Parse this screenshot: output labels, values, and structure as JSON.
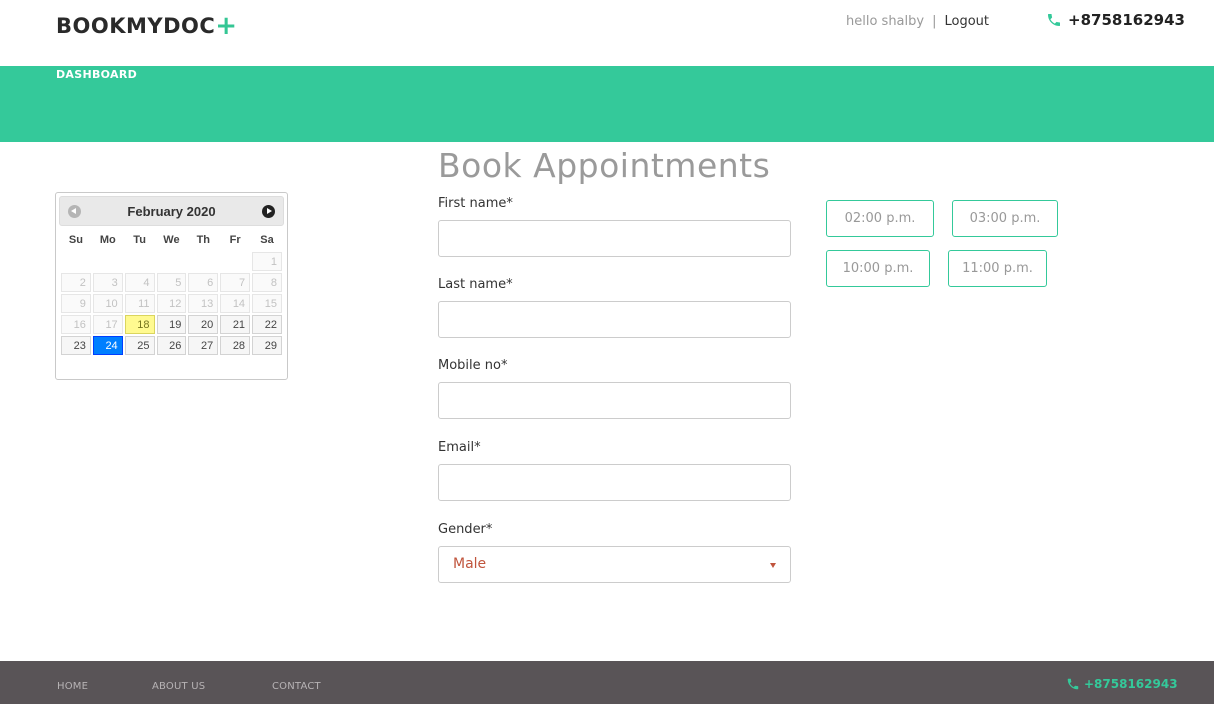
{
  "header": {
    "logo_text": "BOOKMYDOC",
    "logo_plus": "+",
    "greeting": "hello shalby",
    "separator": "|",
    "logout": "Logout",
    "phone": "+8758162943",
    "phone_icon": "phone-icon"
  },
  "navbar": {
    "dashboard": "DASHBOARD",
    "color": "#34c99a"
  },
  "calendar": {
    "month_label": "February 2020",
    "weekdays": [
      "Su",
      "Mo",
      "Tu",
      "We",
      "Th",
      "Fr",
      "Sa"
    ],
    "weeks": [
      [
        "",
        "",
        "",
        "",
        "",
        "",
        "1"
      ],
      [
        "2",
        "3",
        "4",
        "5",
        "6",
        "7",
        "8"
      ],
      [
        "9",
        "10",
        "11",
        "12",
        "13",
        "14",
        "15"
      ],
      [
        "16",
        "17",
        "18",
        "19",
        "20",
        "21",
        "22"
      ],
      [
        "23",
        "24",
        "25",
        "26",
        "27",
        "28",
        "29"
      ]
    ],
    "today": "18",
    "selected": "24"
  },
  "form": {
    "title": "Book Appointments",
    "first_name_label": "First name*",
    "first_name_value": "",
    "last_name_label": "Last name*",
    "last_name_value": "",
    "mobile_label": "Mobile no*",
    "mobile_value": "",
    "email_label": "Email*",
    "email_value": "",
    "gender_label": "Gender*",
    "gender_value": "Male"
  },
  "slots": [
    "02:00 p.m.",
    "03:00 p.m.",
    "10:00 p.m.",
    "11:00 p.m."
  ],
  "footer": {
    "home": "HOME",
    "about": "ABOUT US",
    "contact": "CONTACT",
    "phone": "+8758162943"
  }
}
